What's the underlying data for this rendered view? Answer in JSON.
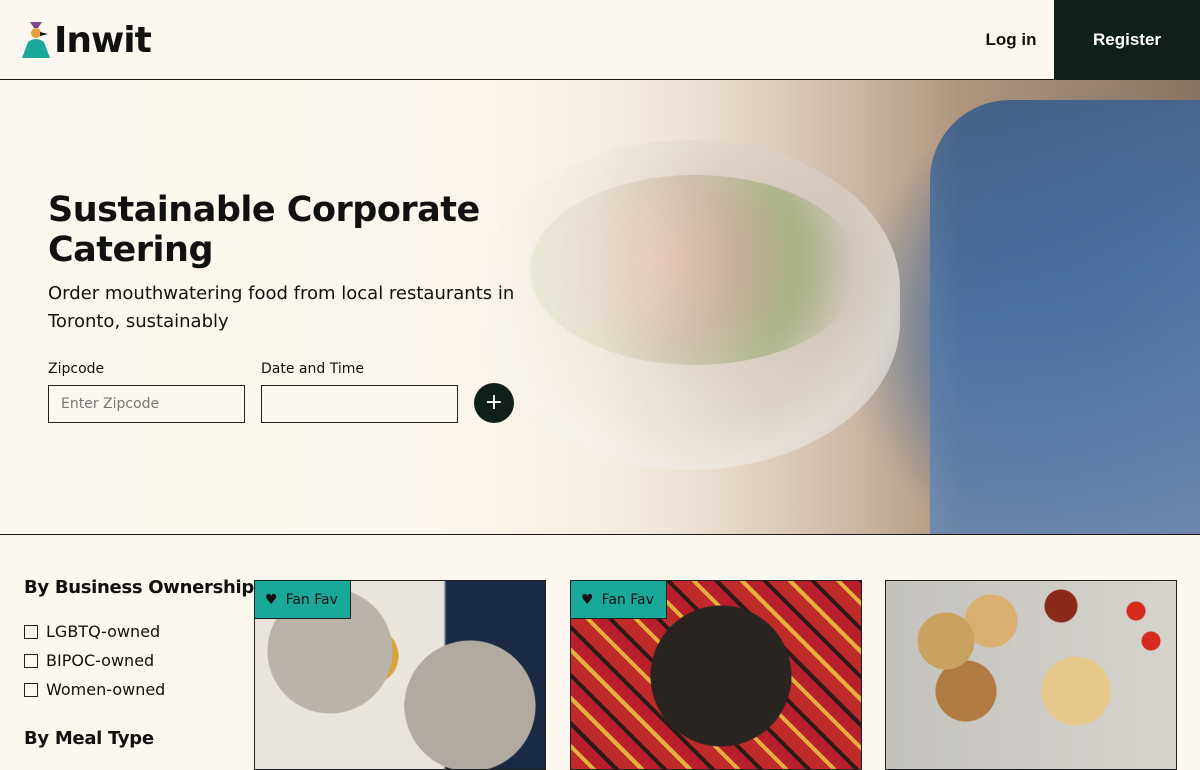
{
  "header": {
    "brand": "Inwit",
    "login_label": "Log in",
    "register_label": "Register"
  },
  "hero": {
    "title": "Sustainable Corporate Catering",
    "subtitle": "Order mouthwatering food from local restaurants in Toronto, sustainably",
    "zipcode_label": "Zipcode",
    "zipcode_placeholder": "Enter Zipcode",
    "zipcode_value": "",
    "datetime_label": "Date and Time",
    "datetime_value": "",
    "submit_icon": "plus-icon",
    "submit_glyph": "+"
  },
  "filters": {
    "ownership_heading": "By Business Ownership",
    "ownership_options": [
      {
        "label": "LGBTQ-owned",
        "checked": false
      },
      {
        "label": "BIPOC-owned",
        "checked": false
      },
      {
        "label": "Women-owned",
        "checked": false
      }
    ],
    "meal_type_heading": "By Meal Type"
  },
  "cards": [
    {
      "badge": "Fan Fav",
      "badge_icon": "heart-icon"
    },
    {
      "badge": "Fan Fav",
      "badge_icon": "heart-icon"
    },
    {
      "badge": ""
    }
  ],
  "colors": {
    "background": "#fdf8ef",
    "dark": "#0f1f1a",
    "badge": "#1aa89a",
    "logo_teal": "#1aa89a",
    "logo_purple": "#7a4a8c",
    "logo_orange": "#e8a23a"
  }
}
